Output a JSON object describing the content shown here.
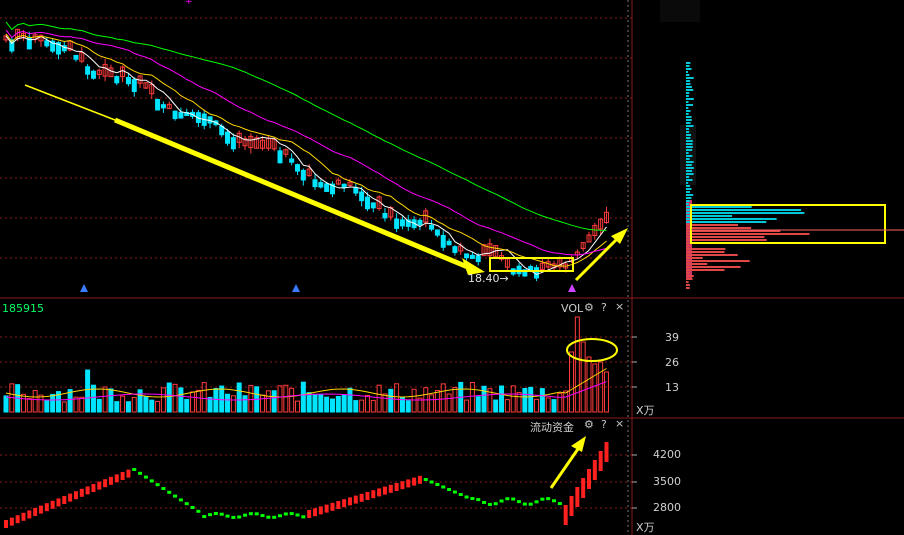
{
  "price_panel": {
    "low_marker": "18.40"
  },
  "volume_panel": {
    "code": "185915",
    "title": "VOL",
    "unit": "X万",
    "ticks": [
      "39",
      "26",
      "13"
    ],
    "tick_values": [
      39,
      26,
      13
    ]
  },
  "flow_panel": {
    "title": "流动资金",
    "unit": "X万",
    "ticks": [
      "4200",
      "3500",
      "2800"
    ],
    "tick_values": [
      4200,
      3500,
      2800
    ]
  },
  "icons": {
    "settings": "gear-icon",
    "help": "?",
    "close": "×"
  },
  "colors": {
    "up": "#ff3c3c",
    "down": "#00e5ff",
    "grid": "#8b1a1a",
    "ma_fast": "#ffffff",
    "ma_mid": "#ffd700",
    "ma_slow": "#ff00ff",
    "ma_long": "#00ff00",
    "annotation": "#ffff00",
    "flow_up": "#ff2020",
    "flow_down": "#00ff00"
  },
  "chart_data": [
    {
      "type": "candlestick",
      "title": "",
      "annotations": [
        "18.40"
      ],
      "trend": "long downtrend followed by a consolidation box and a breakout upward"
    },
    {
      "type": "bar",
      "title": "VOL",
      "ylabel": "X万",
      "yticks": [
        13,
        26,
        39
      ]
    },
    {
      "type": "line",
      "title": "流动资金",
      "ylabel": "X万",
      "yticks": [
        2800,
        3500,
        4200
      ]
    }
  ]
}
